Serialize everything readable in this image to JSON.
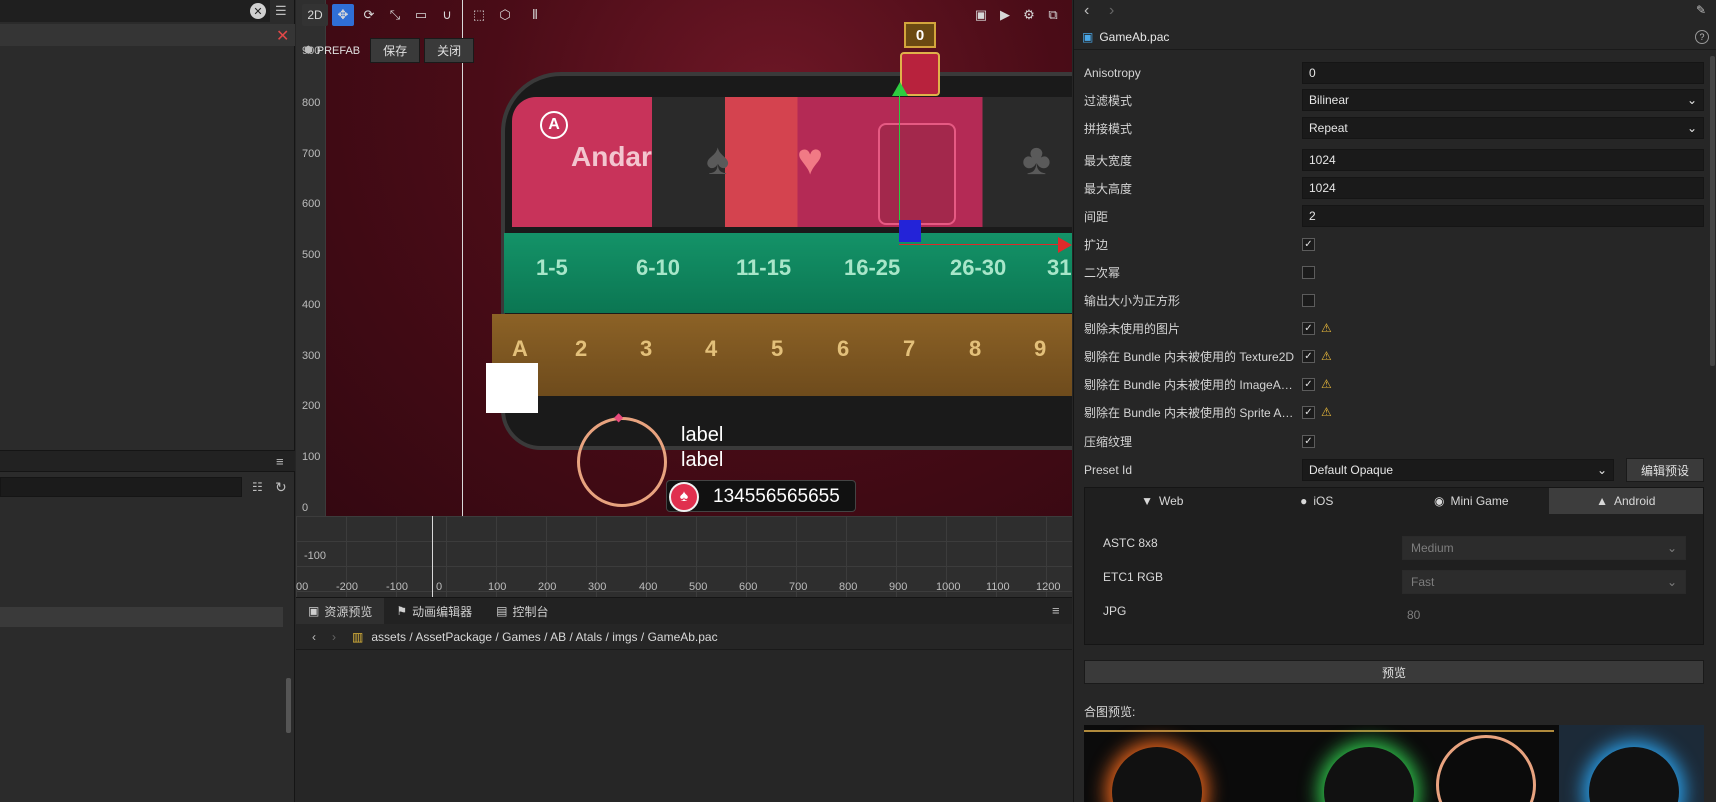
{
  "left_panel": {
    "close_icon": "close-icon"
  },
  "scene": {
    "toolbar": {
      "mode_2d": "2D",
      "prefab_label": "PREFAB",
      "save_label": "保存",
      "close_label": "关闭"
    },
    "ruler_y": [
      "900",
      "800",
      "700",
      "600",
      "500",
      "400",
      "300",
      "200",
      "100",
      "0",
      "-100"
    ],
    "ruler_x": [
      "00",
      "-200",
      "-100",
      "0",
      "100",
      "200",
      "300",
      "400",
      "500",
      "600",
      "700",
      "800",
      "900",
      "1000",
      "1100",
      "1200"
    ],
    "game": {
      "andar_label": "Andar",
      "andar_badge": "A",
      "counter": "0",
      "ranges": [
        "1-5",
        "6-10",
        "11-15",
        "16-25",
        "26-30",
        "31"
      ],
      "ranks": [
        "A",
        "2",
        "3",
        "4",
        "5",
        "6",
        "7",
        "8",
        "9"
      ],
      "label_1": "label",
      "label_2": "label",
      "chips_value": "134556565655"
    }
  },
  "bottom_panel": {
    "tabs": [
      "资源预览",
      "动画编辑器",
      "控制台"
    ],
    "breadcrumb": [
      "assets",
      "AssetPackage",
      "Games",
      "AB",
      "Atals",
      "imgs",
      "GameAb.pac"
    ]
  },
  "inspector": {
    "title": "GameAb.pac",
    "rows": {
      "anisotropy": {
        "label": "Anisotropy",
        "value": "0"
      },
      "filter": {
        "label": "过滤模式",
        "value": "Bilinear"
      },
      "wrap": {
        "label": "拼接模式",
        "value": "Repeat"
      },
      "max_width": {
        "label": "最大宽度",
        "value": "1024"
      },
      "max_height": {
        "label": "最大高度",
        "value": "1024"
      },
      "padding": {
        "label": "间距",
        "value": "2"
      },
      "extrude": {
        "label": "扩边",
        "checked": true
      },
      "power_of_two": {
        "label": "二次幂",
        "checked": false
      },
      "square": {
        "label": "输出大小为正方形",
        "checked": false
      },
      "remove_unused": {
        "label": "剔除未使用的图片",
        "checked": true,
        "warn": true
      },
      "remove_texture2d": {
        "label": "剔除在 Bundle 内未被使用的 Texture2D",
        "checked": true,
        "warn": true
      },
      "remove_imageasset": {
        "label": "剔除在 Bundle 内未被使用的 ImageA…",
        "checked": true,
        "warn": true
      },
      "remove_spriteatlas": {
        "label": "剔除在 Bundle 内未被使用的 Sprite A…",
        "checked": true,
        "warn": true
      },
      "compress": {
        "label": "压缩纹理",
        "checked": true
      }
    },
    "preset": {
      "label": "Preset Id",
      "value": "Default Opaque",
      "edit_button": "编辑预设"
    },
    "platform_tabs": [
      "Web",
      "iOS",
      "Mini Game",
      "Android"
    ],
    "active_platform": "Android",
    "formats": [
      {
        "name": "ASTC 8x8",
        "value": "Medium"
      },
      {
        "name": "ETC1 RGB",
        "value": "Fast"
      },
      {
        "name": "JPG",
        "value": "80"
      }
    ],
    "preview_button": "预览",
    "preview_title": "合图预览:"
  }
}
